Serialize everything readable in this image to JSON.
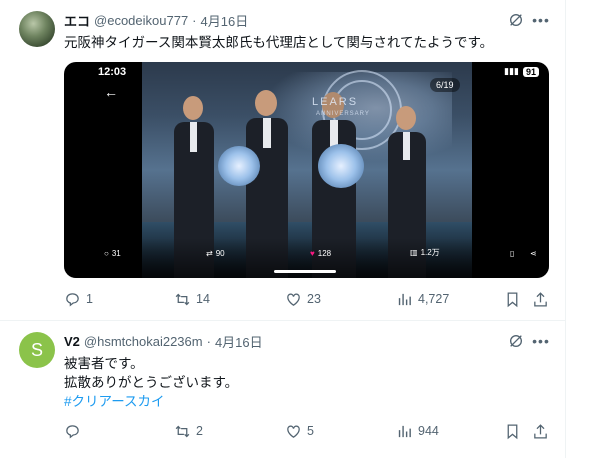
{
  "tweets": [
    {
      "name": "エコ",
      "handle": "@ecodeikou777",
      "dot": "·",
      "date": "4月16日",
      "text_lines": [
        "元阪神タイガース関本賢太郎氏も代理店として関与されてたようです。"
      ],
      "media": {
        "status_time": "12:03",
        "battery": "91",
        "counter": "6/19",
        "banner": "LEARS",
        "banner_sub": "ANNIVERSARY",
        "replies": "31",
        "retweets": "90",
        "likes": "128",
        "views": "1.2万"
      },
      "stats": {
        "replies": "1",
        "retweets": "14",
        "likes": "23",
        "views": "4,727"
      }
    },
    {
      "name": "V2",
      "avatar_letter": "S",
      "handle": "@hsmtchokai2236m",
      "dot": "·",
      "date": "4月16日",
      "text_lines": [
        "被害者です。",
        "拡散ありがとうございます。"
      ],
      "hashtag": "#クリアースカイ",
      "stats": {
        "replies": "",
        "retweets": "2",
        "likes": "5",
        "views": "944"
      }
    }
  ],
  "icons": [
    "grok-icon",
    "more-icon",
    "reply-icon",
    "retweet-icon",
    "like-icon",
    "views-icon",
    "bookmark-icon",
    "share-icon"
  ],
  "colors": {
    "accent": "#1d9bf0",
    "secondary_text": "#536471",
    "like_pink": "#f91880",
    "border": "#eff3f4"
  }
}
